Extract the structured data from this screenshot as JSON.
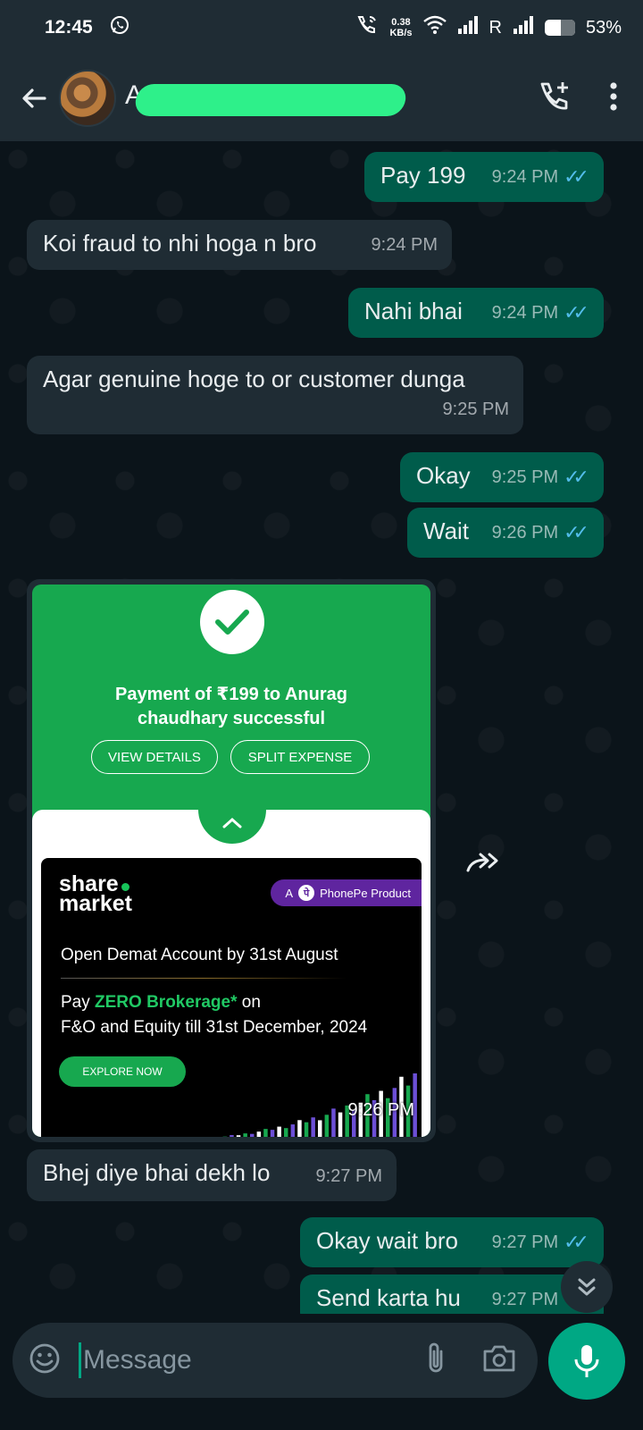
{
  "status_bar": {
    "time": "12:45",
    "net_speed_value": "0.38",
    "net_speed_unit": "KB/s",
    "roaming": "R",
    "battery": "53%"
  },
  "header": {
    "contact_name": "A"
  },
  "messages": [
    {
      "dir": "out",
      "text": "Pay 199",
      "time": "9:24 PM"
    },
    {
      "dir": "in",
      "text": "Koi fraud to nhi hoga n bro",
      "time": "9:24 PM"
    },
    {
      "dir": "out",
      "text": "Nahi bhai",
      "time": "9:24 PM"
    },
    {
      "dir": "in",
      "text": "Agar genuine hoge to or customer dunga",
      "time": "9:25 PM"
    },
    {
      "dir": "out",
      "text": "Okay",
      "time": "9:25 PM"
    },
    {
      "dir": "out",
      "text": "Wait",
      "time": "9:26 PM"
    },
    {
      "dir": "in",
      "text": "Bhej diye bhai dekh lo",
      "time": "9:27 PM"
    },
    {
      "dir": "out",
      "text": "Okay wait bro",
      "time": "9:27 PM"
    },
    {
      "dir": "out",
      "text": "Send karta hu",
      "time": "9:27 PM"
    }
  ],
  "image_message": {
    "time": "9:26 PM",
    "payment_line1": "Payment of ₹199 to Anurag",
    "payment_line2": "chaudhary successful",
    "view_details": "VIEW DETAILS",
    "split_expense": "SPLIT EXPENSE",
    "logo_line1": "share",
    "logo_line2": "market",
    "badge_prefix": "A",
    "badge_text": "PhonePe Product",
    "demat_line": "Open Demat Account by 31st August",
    "pay_prefix": "Pay ",
    "zero_text": "ZERO Brokerage*",
    "pay_suffix": " on",
    "fo_line": "F&O and Equity till 31st December, 2024",
    "explore": "EXPLORE NOW"
  },
  "composer": {
    "placeholder": "Message"
  },
  "colors": {
    "bg": "#0b141a",
    "bar": "#1f2c34",
    "outgoing": "#005c4b",
    "incoming": "#1f2c34",
    "accent": "#00a884",
    "read_ticks": "#53bdeb",
    "phonepe_green": "#17a84f",
    "phonepe_purple": "#5f259f"
  }
}
